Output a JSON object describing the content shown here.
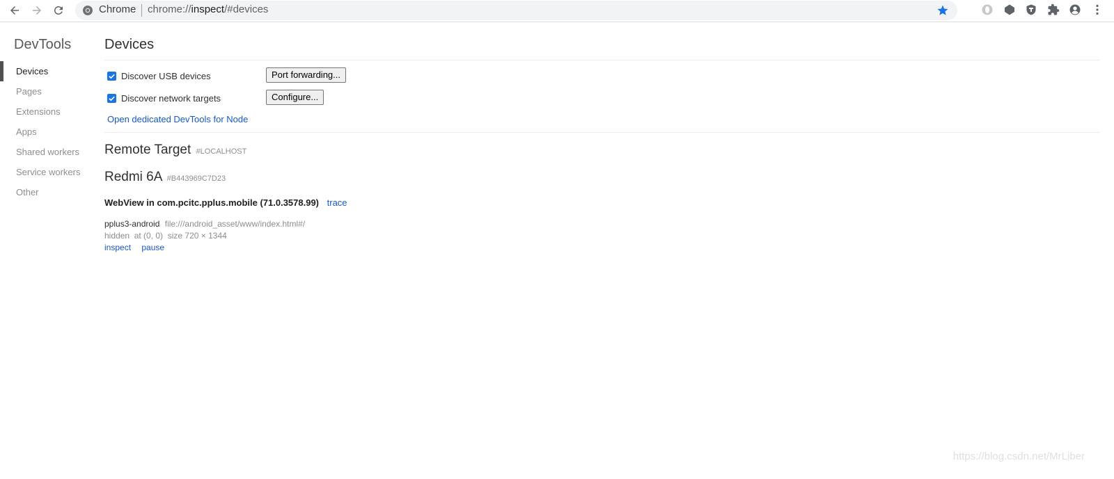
{
  "browser": {
    "site_name": "Chrome",
    "url_scheme": "chrome://",
    "url_host": "inspect",
    "url_path": "/#devices"
  },
  "sidebar": {
    "title": "DevTools",
    "items": [
      {
        "label": "Devices",
        "selected": true
      },
      {
        "label": "Pages"
      },
      {
        "label": "Extensions"
      },
      {
        "label": "Apps"
      },
      {
        "label": "Shared workers"
      },
      {
        "label": "Service workers"
      },
      {
        "label": "Other"
      }
    ]
  },
  "main": {
    "title": "Devices",
    "options": {
      "usb": {
        "label": "Discover USB devices",
        "checked": true,
        "button": "Port forwarding..."
      },
      "network": {
        "label": "Discover network targets",
        "checked": true,
        "button": "Configure..."
      }
    },
    "node_link": "Open dedicated DevTools for Node",
    "remote_target": {
      "title": "Remote Target",
      "sub": "#LOCALHOST"
    },
    "device": {
      "name": "Redmi 6A",
      "serial": "#B443969C7D23"
    },
    "browser_entry": {
      "name": "WebView in com.pcitc.pplus.mobile (71.0.3578.99)",
      "trace_link": "trace"
    },
    "target": {
      "name": "pplus3-android",
      "url": "file:///android_asset/www/index.html#/",
      "meta": "hidden  at (0, 0)  size 720 × 1344",
      "inspect": "inspect",
      "pause": "pause"
    }
  },
  "watermark": "https://blog.csdn.net/MrLiber",
  "colors": {
    "accent": "#1a73e8",
    "link": "#1558d6"
  }
}
